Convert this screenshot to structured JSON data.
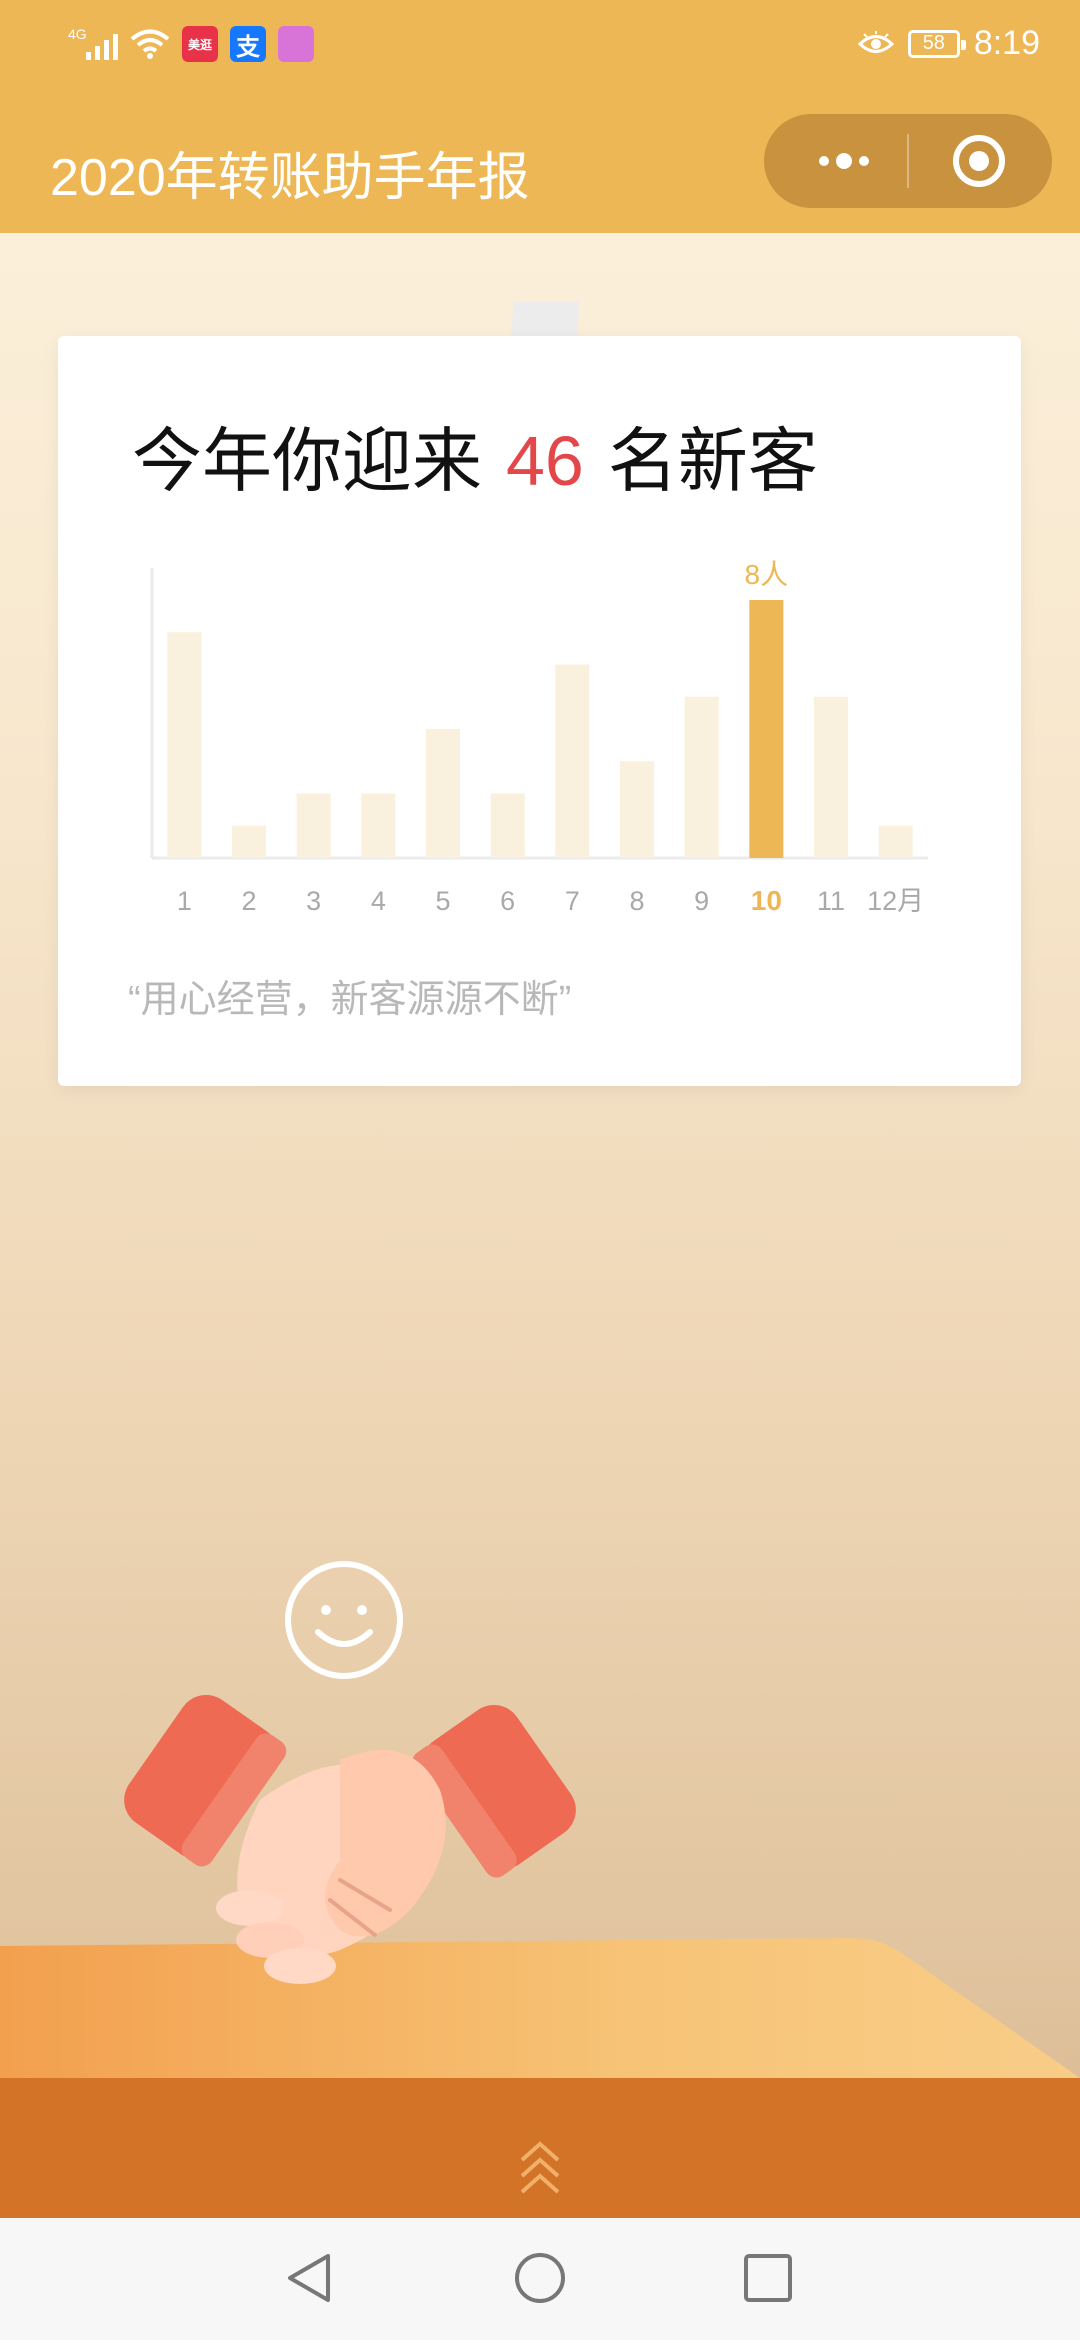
{
  "status_bar": {
    "network": "4G",
    "app_icons": [
      {
        "label": "美逛",
        "color": "#e8324a"
      },
      {
        "label": "支",
        "color": "#1677ff"
      },
      {
        "label": "",
        "color": "#d873d8"
      }
    ],
    "battery": "58",
    "time": "8:19"
  },
  "header": {
    "title": "2020年转账助手年报"
  },
  "card": {
    "headline_prefix": "今年你迎来",
    "headline_number": "46",
    "headline_suffix": "名新客",
    "tagline": "“用心经营，新客源源不断”"
  },
  "chart_data": {
    "type": "bar",
    "categories": [
      "1",
      "2",
      "3",
      "4",
      "5",
      "6",
      "7",
      "8",
      "9",
      "10",
      "11",
      "12月"
    ],
    "values": [
      7,
      1,
      2,
      2,
      4,
      2,
      6,
      3,
      5,
      8,
      5,
      1
    ],
    "highlight_index": 9,
    "highlight_label": "8人",
    "ylim": [
      0,
      8
    ],
    "grid": false,
    "colors": {
      "bar": "#f9f0dd",
      "highlight": "#eeb755",
      "axis": "#ebebeb",
      "tick": "#a9a9a9"
    }
  },
  "colors": {
    "accent": "#eeb755",
    "red": "#e4474a",
    "table": "#d27328"
  }
}
